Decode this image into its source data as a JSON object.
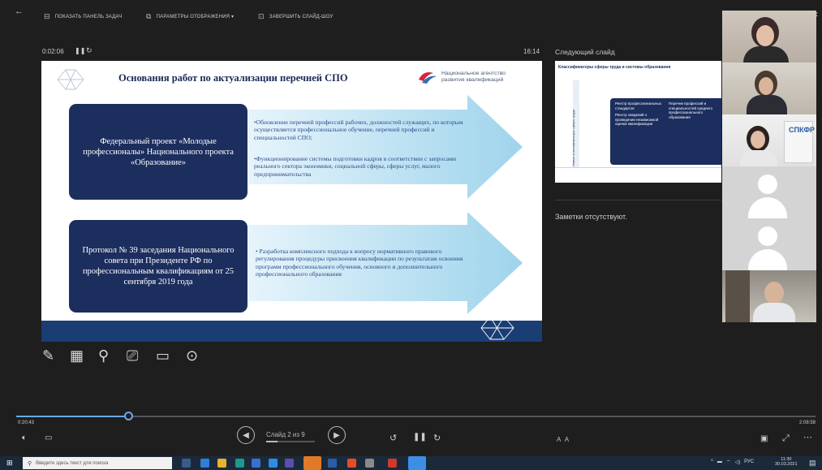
{
  "toolbar": {
    "show_taskbar": "Показать панель задач",
    "display_settings": "Параметры отображения ▾",
    "end_show": "Завершить слайд-шоу"
  },
  "presenter": {
    "timer": "0:02:06",
    "clock": "16:14",
    "next_slide_label": "Следующий слайд",
    "notes_text": "Заметки отсутствуют.",
    "slide_counter": "Слайд 2 из 9",
    "elapsed": "0:20:43",
    "remaining": "2:08:58",
    "progress_fraction": 0.14
  },
  "slide": {
    "title": "Основания работ по актуализации перечней СПО",
    "agency_line1": "Национальное агентство",
    "agency_line2": "развития квалификаций",
    "box1": "Федеральный проект «Молодые профессионалы» Национального проекта «Образование»",
    "arrow1_item1": "•Обновление перечней профессий рабочих, должностей служащих, по которым осуществляется профессиональное обучение, перечней профессий и специальностей СПО;",
    "arrow1_item2": "•Функционирование системы подготовки кадров в соответствии с запросами реального сектора экономики, социальной сферы, сферы услуг, малого предпринимательства",
    "box2": "Протокол № 39 заседания Национального совета при Президенте РФ по профессиональным квалификациям от 25 сентября 2019 года",
    "arrow2_item1": "• Разработка комплексного подхода к вопросу нормативного правового регулирования процедуры присвоения квалификации по результатам освоения программ профессионального обучения, основного и дополнительного профессионального образования"
  },
  "next_slide": {
    "title": "Классификаторы сферы труда и системы образования",
    "vertical_label": "Новые классификаторы сферы труда",
    "col1_item1": "Реестр профессиональных стандартов",
    "col1_item2": "Реестр сведений о проведении независимой оценки квалификации",
    "col2_item1": "Перечни профессий и специальностей среднего профессионального образования"
  },
  "participants": {
    "badge": "СПКФР"
  },
  "taskbar": {
    "search_placeholder": "Введите здесь текст для поиска",
    "lang": "РУС",
    "time": "11:30",
    "date": "30.03.2021"
  },
  "colors": {
    "slide_navy": "#1c2e5e",
    "slide_footer": "#1a3d74",
    "progress_accent": "#6aa9e6"
  }
}
